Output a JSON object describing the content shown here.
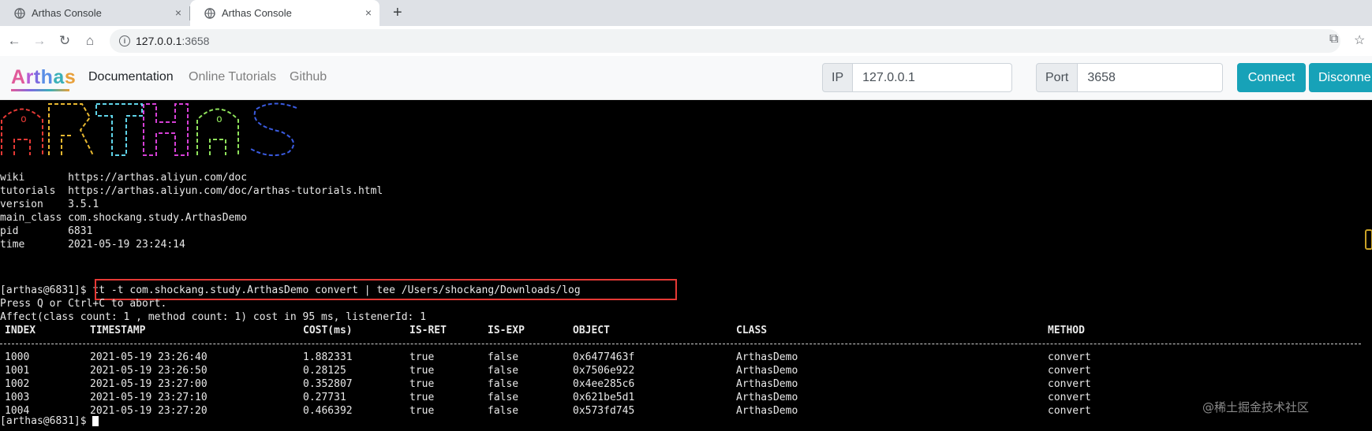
{
  "browser": {
    "tabs": [
      {
        "title": "Arthas Console",
        "active": false
      },
      {
        "title": "Arthas Console",
        "active": true
      }
    ],
    "url_host": "127.0.0.1",
    "url_port": ":3658",
    "new_tab_label": "+",
    "close_label": "×"
  },
  "navbar": {
    "brand": [
      "A",
      "r",
      "t",
      "h",
      "a",
      "s"
    ],
    "links": [
      "Documentation",
      "Online Tutorials",
      "Github"
    ],
    "ip_label": "IP",
    "ip_value": "127.0.0.1",
    "port_label": "Port",
    "port_value": "3658",
    "connect_label": "Connect",
    "disconnect_label": "Disconne"
  },
  "terminal": {
    "info": [
      {
        "key": "wiki",
        "value": "https://arthas.aliyun.com/doc"
      },
      {
        "key": "tutorials",
        "value": "https://arthas.aliyun.com/doc/arthas-tutorials.html"
      },
      {
        "key": "version",
        "value": "3.5.1"
      },
      {
        "key": "main_class",
        "value": "com.shockang.study.ArthasDemo"
      },
      {
        "key": "pid",
        "value": "6831"
      },
      {
        "key": "time",
        "value": "2021-05-19 23:24:14"
      }
    ],
    "prompt": "[arthas@6831]$ ",
    "command": "tt -t com.shockang.study.ArthasDemo convert | tee /Users/shockang/Downloads/log",
    "abort_hint": "Press Q or Ctrl+C to abort.",
    "affect_line": "Affect(class count: 1 , method count: 1) cost in 95 ms, listenerId: 1",
    "columns": [
      "INDEX",
      "TIMESTAMP",
      "COST(ms)",
      "IS-RET",
      "IS-EXP",
      "OBJECT",
      "CLASS",
      "METHOD"
    ],
    "rows": [
      [
        "1000",
        "2021-05-19 23:26:40",
        "1.882331",
        "true",
        "false",
        "0x6477463f",
        "ArthasDemo",
        "convert"
      ],
      [
        "1001",
        "2021-05-19 23:26:50",
        "0.28125",
        "true",
        "false",
        "0x7506e922",
        "ArthasDemo",
        "convert"
      ],
      [
        "1002",
        "2021-05-19 23:27:00",
        "0.352807",
        "true",
        "false",
        "0x4ee285c6",
        "ArthasDemo",
        "convert"
      ],
      [
        "1003",
        "2021-05-19 23:27:10",
        "0.27731",
        "true",
        "false",
        "0x621be5d1",
        "ArthasDemo",
        "convert"
      ],
      [
        "1004",
        "2021-05-19 23:27:20",
        "0.466392",
        "true",
        "false",
        "0x573fd745",
        "ArthasDemo",
        "convert"
      ]
    ],
    "final_prompt": "[arthas@6831]$ ",
    "logo_colors": [
      "#e53935",
      "#e8b830",
      "#5fd3e8",
      "#d63fd6",
      "#8fe35b",
      "#3a5be0",
      "#e8e8e8"
    ]
  },
  "watermark": "@稀土掘金技术社区"
}
